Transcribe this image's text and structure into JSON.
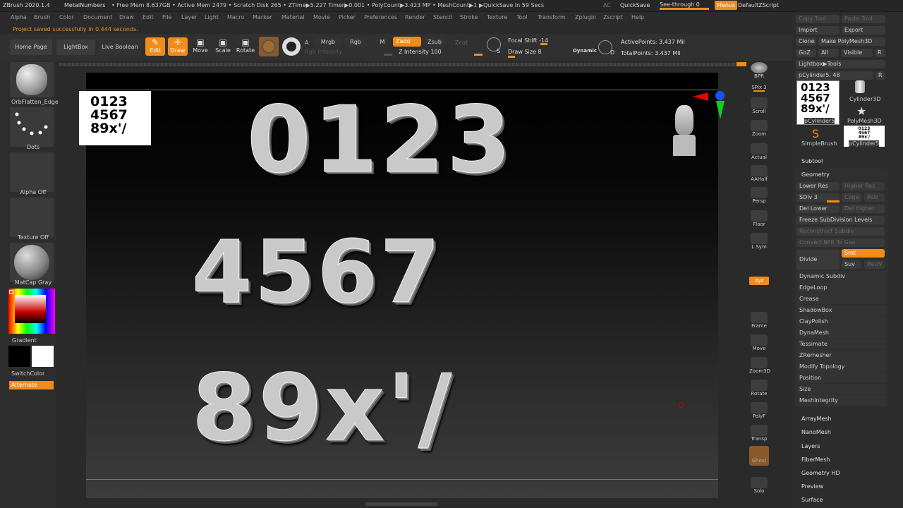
{
  "titlebar": {
    "app": "ZBrush 2020.1.4",
    "doc": "MetalNumbers",
    "stats": "• Free Mem 8.637GB • Active Mem 2479 • Scratch Disk 265 • ZTime▶5.227 Timer▶0.001 • PolyCount▶3.423 MP • MeshCount▶1 ▶QuickSave In 59 Secs",
    "ac": "AC",
    "quicksave": "QuickSave",
    "seethrough": "See-through  0",
    "menus": "Menus",
    "script": "DefaultZScript"
  },
  "menu": [
    "Alpha",
    "Brush",
    "Color",
    "Document",
    "Draw",
    "Edit",
    "File",
    "Layer",
    "Light",
    "Macro",
    "Marker",
    "Material",
    "Movie",
    "Picker",
    "Preferences",
    "Render",
    "Stencil",
    "Stroke",
    "Texture",
    "Tool",
    "Transform",
    "Zplugin",
    "Zscript",
    "Help"
  ],
  "status": "Project saved successfully in 0.444 seconds.",
  "shelf": {
    "home": "Home Page",
    "lightbox": "LightBox",
    "liveboolean": "Live Boolean",
    "edit": "Edit",
    "draw": "Draw",
    "move": "Move",
    "scale": "Scale",
    "rotate": "Rotate",
    "a": "A",
    "mrgb": "Mrgb",
    "rgb": "Rgb",
    "m": "M",
    "zadd": "Zadd",
    "zsub": "Zsub",
    "zcut": "Zcut",
    "rgbint": "Rgb Intensity",
    "zint": "Z Intensity 100",
    "focal": "Focal Shift -14",
    "drawsize": "Draw Size 8",
    "dynamic": "Dynamic",
    "active": "ActivePoints: 3.437 Mil",
    "total": "TotalPoints: 3.437 Mil",
    "s": "S",
    "d": "D"
  },
  "left": {
    "brush": "OrbFlatten_Edge",
    "stroke": "Dots",
    "alpha": "Alpha Off",
    "texture": "Texture Off",
    "material": "MatCap Gray",
    "gradient": "Gradient",
    "switch": "SwitchColor",
    "alternate": "Alternate"
  },
  "viewport": {
    "alpha_lines": [
      "0123",
      "4567",
      "89x'/"
    ],
    "row1": "0123",
    "row2": "4567",
    "row3": "89x'/"
  },
  "rshelf": [
    "BPR",
    "SPix 3",
    "Scroll",
    "Zoom",
    "Actual",
    "AAHalf",
    "Persp",
    "Floor",
    "L.Sym",
    "Xyz",
    "Frame",
    "Move",
    "Zoom3D",
    "Rotate",
    "PolyF",
    "Transp",
    "Ghost",
    "Solo"
  ],
  "rpanel": {
    "copytool": "Copy Tool",
    "pastetool": "Paste Tool",
    "import": "Import",
    "export": "Export",
    "clone": "Clone",
    "makepoly": "Make PolyMesh3D",
    "goz": "GoZ",
    "all": "All",
    "visible": "Visible",
    "r": "R",
    "lbtools": "Lightbox▶Tools",
    "tool": "pCylinder5. 48",
    "thumbs": [
      "pCylinder5",
      "Cylinder3D",
      "PolyMesh3D",
      "SimpleBrush",
      "pCylinder5"
    ],
    "subtool": "Subtool",
    "geometry": "Geometry",
    "lowerres": "Lower Res",
    "higherres": "Higher Res",
    "sdiv": "SDiv 3",
    "cage": "Cage",
    "rstr": "Rstr",
    "dellower": "Del Lower",
    "delhigher": "Del Higher",
    "freeze": "Freeze SubDivision Levels",
    "reconstruct": "Reconstruct Subdiv",
    "convert": "Convert BPR To Geo",
    "divide": "Divide",
    "smt": "Smt",
    "suv": "Suv",
    "reuv": "ReUV",
    "items": [
      "Dynamic Subdiv",
      "EdgeLoop",
      "Crease",
      "ShadowBox",
      "ClayPolish",
      "DynaMesh",
      "Tessimate",
      "ZRemesher",
      "Modify Topology",
      "Position",
      "Size",
      "MeshIntegrity"
    ],
    "sections": [
      "ArrayMesh",
      "NanoMesh",
      "Layers",
      "FiberMesh",
      "Geometry HD",
      "Preview",
      "Surface"
    ]
  }
}
